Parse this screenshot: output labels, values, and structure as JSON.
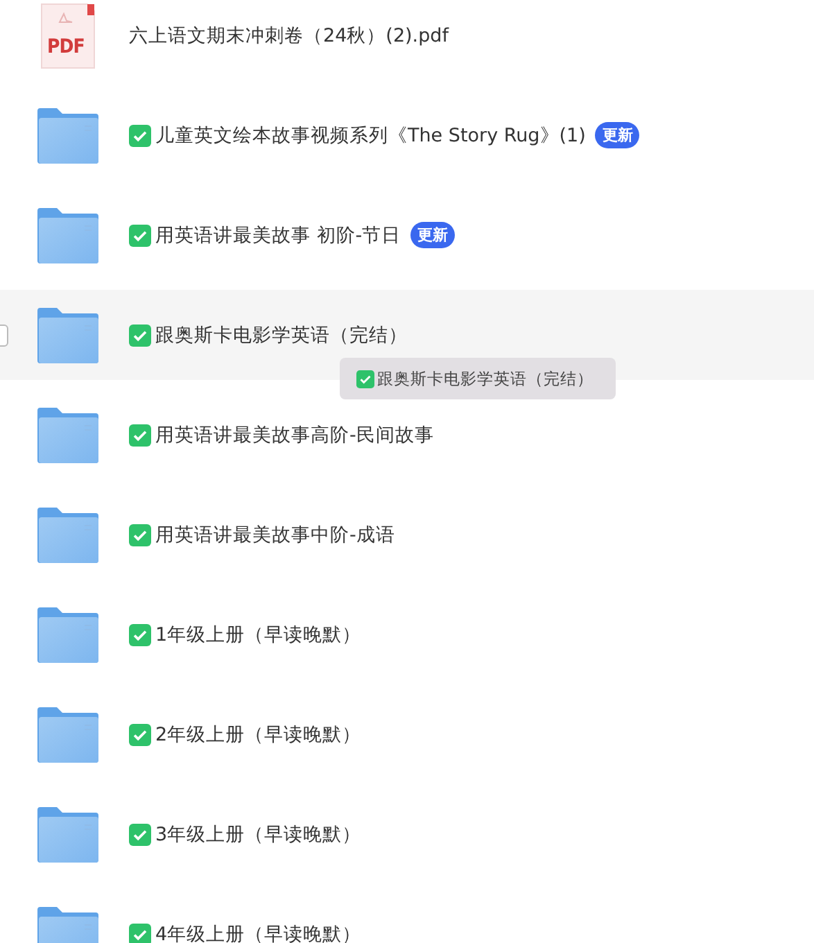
{
  "files": [
    {
      "kind": "pdf",
      "icon_label": "PDF",
      "name": "六上语文期末冲刺卷（24秋）(2).pdf",
      "tagged": false,
      "hovered": false
    },
    {
      "kind": "folder",
      "name": "儿童英文绘本故事视频系列《The Story Rug》(1)",
      "tagged": true,
      "badge": "更新",
      "hovered": false
    },
    {
      "kind": "folder",
      "name": "用英语讲最美故事 初阶-节日",
      "tagged": true,
      "badge": "更新",
      "hovered": false
    },
    {
      "kind": "folder",
      "name": "跟奥斯卡电影学英语（完结）",
      "tagged": true,
      "hovered": true
    },
    {
      "kind": "folder",
      "name": "用英语讲最美故事高阶-民间故事",
      "tagged": true,
      "hovered": false
    },
    {
      "kind": "folder",
      "name": "用英语讲最美故事中阶-成语",
      "tagged": true,
      "hovered": false
    },
    {
      "kind": "folder",
      "name": "1年级上册（早读晚默）",
      "tagged": true,
      "hovered": false
    },
    {
      "kind": "folder",
      "name": "2年级上册（早读晚默）",
      "tagged": true,
      "hovered": false
    },
    {
      "kind": "folder",
      "name": "3年级上册（早读晚默）",
      "tagged": true,
      "hovered": false
    },
    {
      "kind": "folder",
      "name": "4年级上册（早读晚默）",
      "tagged": true,
      "hovered": false
    }
  ],
  "tooltip": {
    "text": "跟奥斯卡电影学英语（完结）",
    "tagged": true
  }
}
